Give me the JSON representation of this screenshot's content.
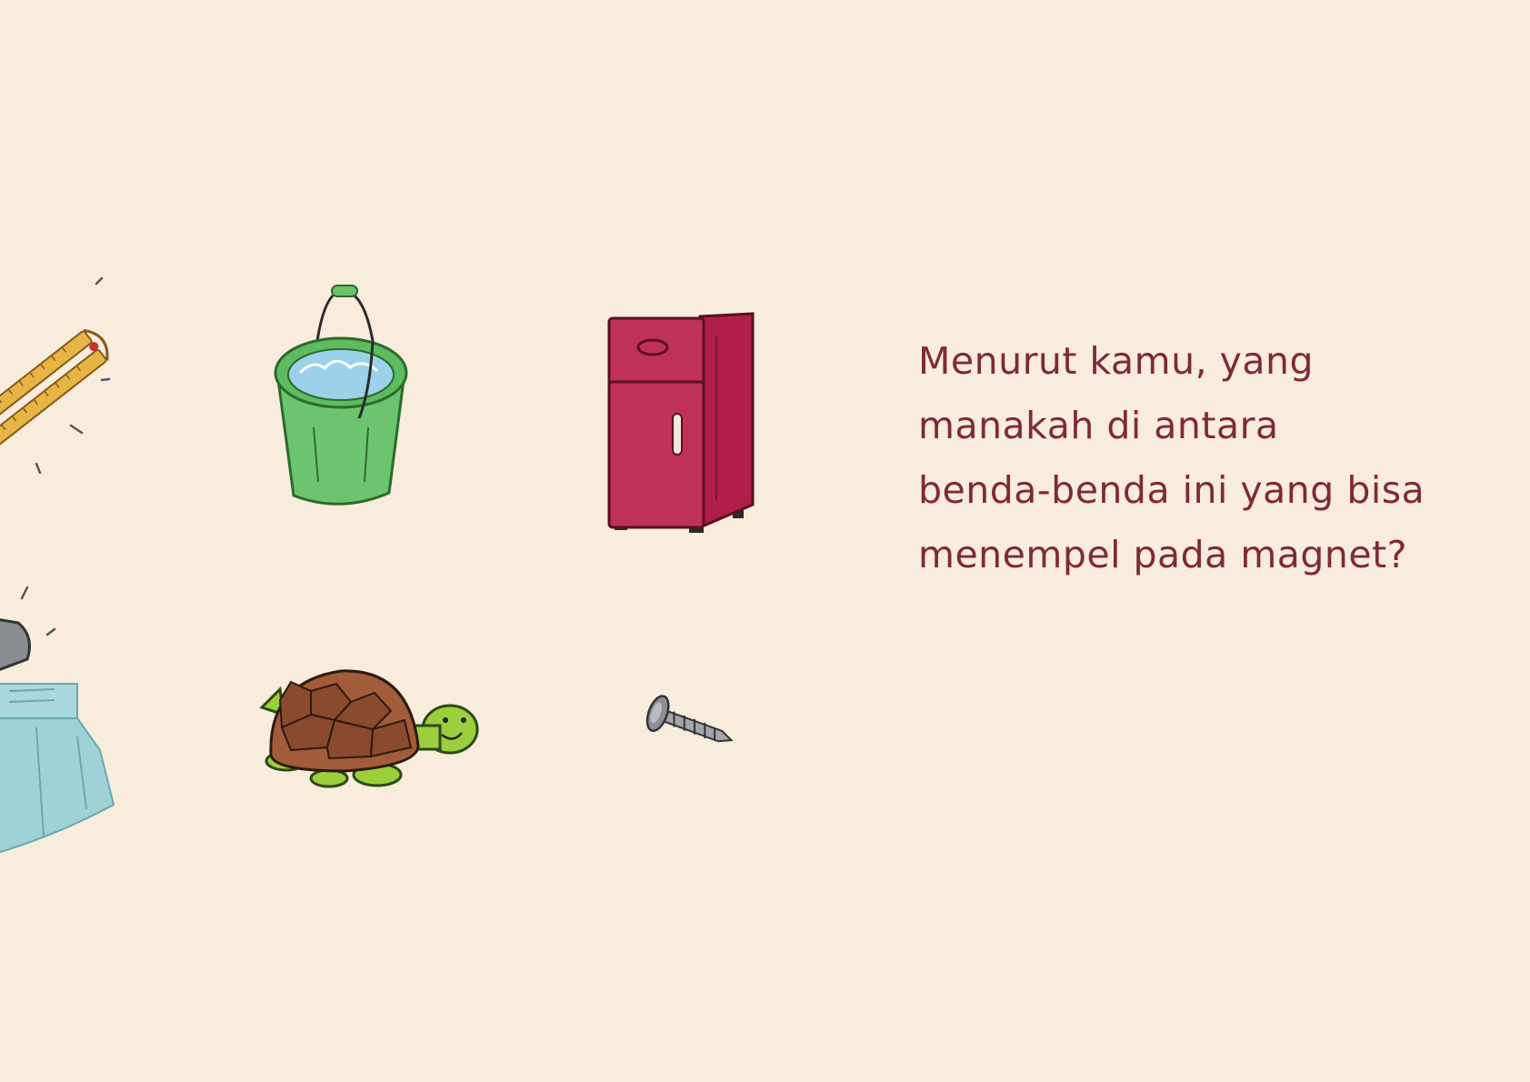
{
  "page": {
    "background_color": "#f8ecdd",
    "text_color": "#7e2b33"
  },
  "question": {
    "lines": [
      "Menurut kamu, yang",
      "manakah di antara",
      "benda-benda ini yang bisa",
      "menempel pada magnet?"
    ]
  },
  "illustrations": [
    {
      "name": "ruler-icon"
    },
    {
      "name": "bucket-icon"
    },
    {
      "name": "refrigerator-icon"
    },
    {
      "name": "glass-jar-icon"
    },
    {
      "name": "turtle-icon"
    },
    {
      "name": "screw-icon"
    }
  ]
}
